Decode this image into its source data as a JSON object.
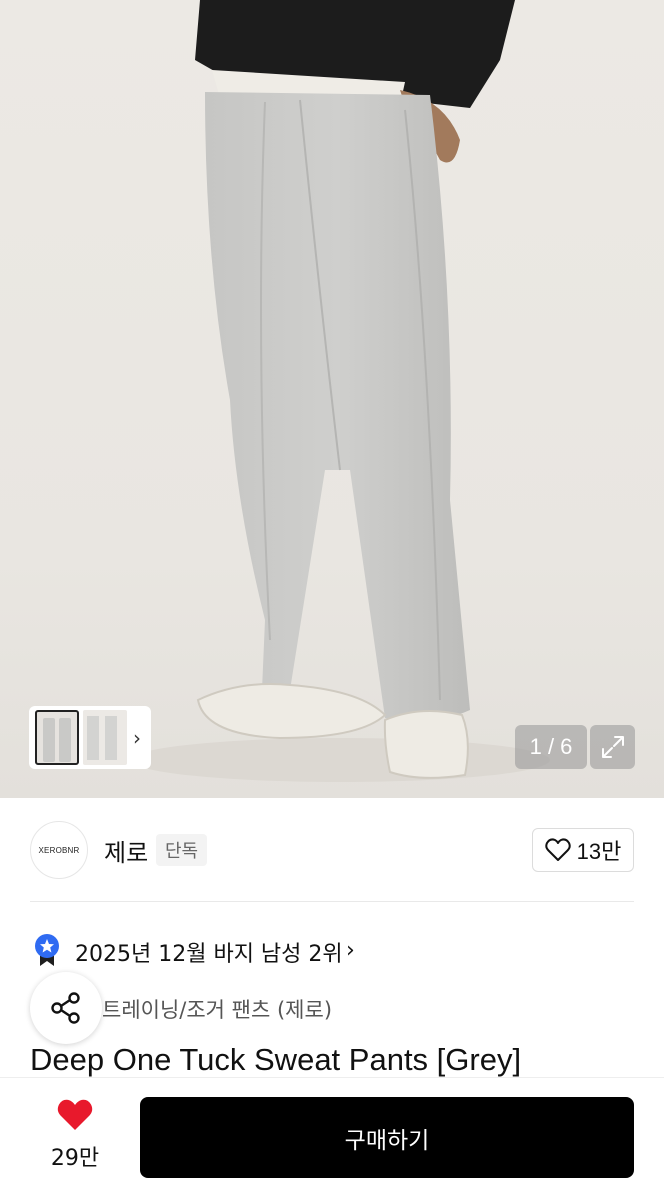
{
  "gallery": {
    "counter": "1 / 6",
    "icons": {
      "expand": "expand-icon",
      "next": "chevron-right-icon"
    }
  },
  "brand": {
    "logo_text": "XEROBNR",
    "name": "제로",
    "badge": "단독",
    "likes": "13만"
  },
  "ranking": {
    "text": "2025년 12월 바지 남성 2위",
    "chevron": "›"
  },
  "product": {
    "category": "트레이닝/조거 팬츠 (제로)",
    "title": "Deep One Tuck Sweat Pants [Grey]"
  },
  "bottom_bar": {
    "wish_count": "29만",
    "buy_label": "구매하기"
  },
  "colors": {
    "accent": "#000000",
    "heart": "#e8192c",
    "rank_badge": "#2f6bf2"
  }
}
